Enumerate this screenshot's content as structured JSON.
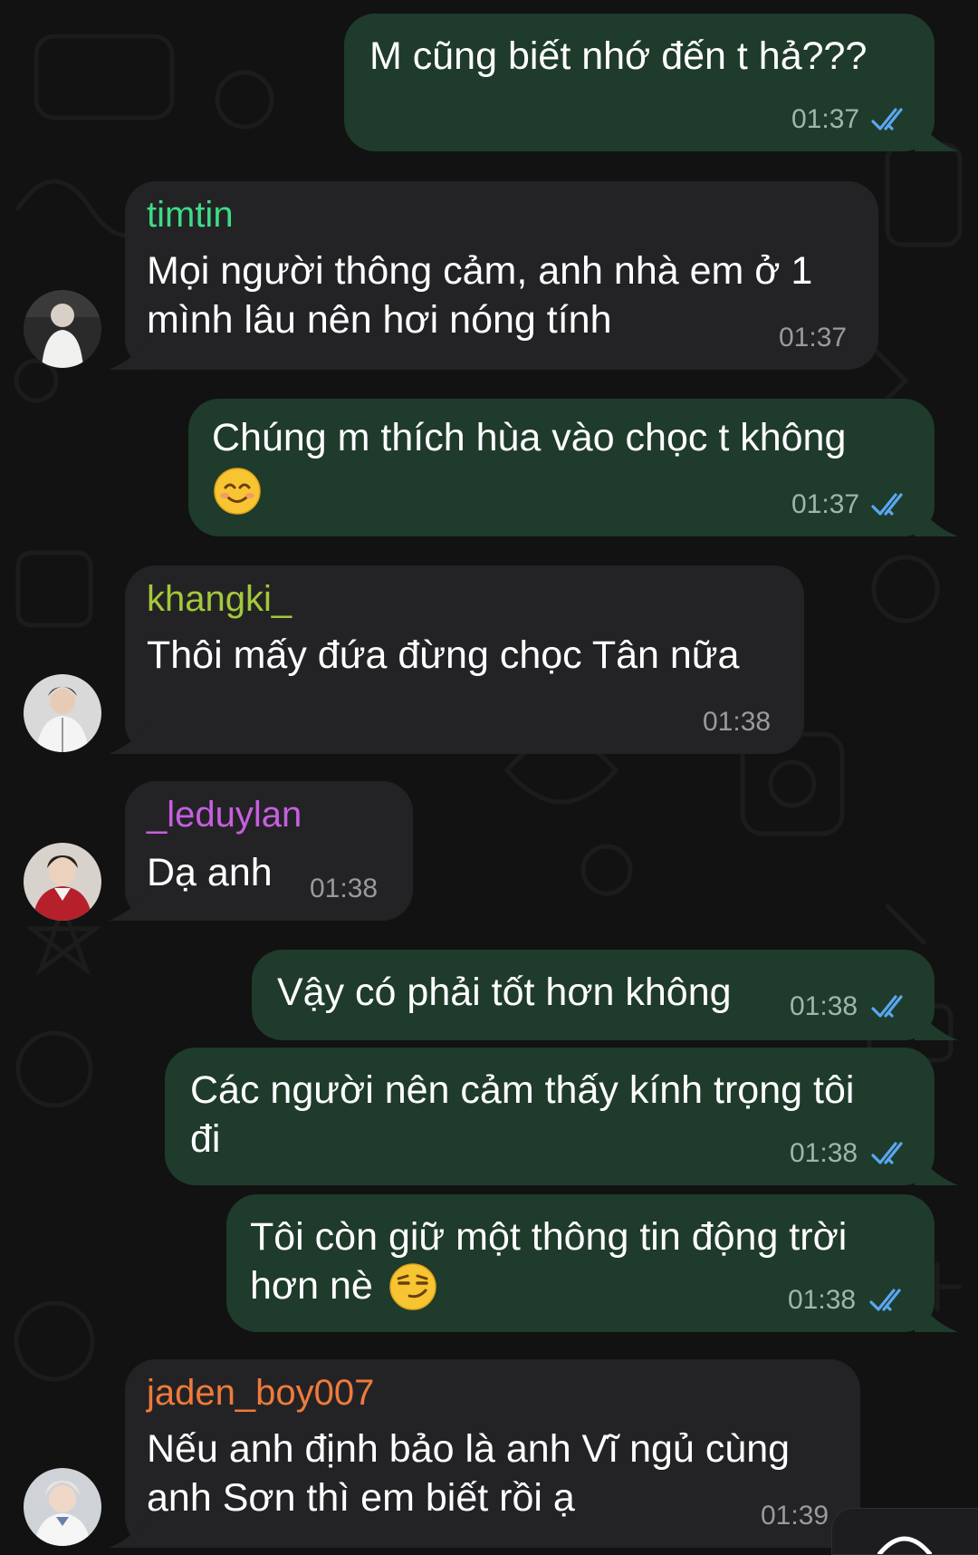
{
  "colors": {
    "outgoing_bubble": "#1f3b2b",
    "incoming_bubble": "#232326",
    "read_check": "#5aa7f2",
    "sender_timtin": "#3ddc84",
    "sender_khangki": "#a3c93a",
    "sender_leduylan": "#c75fe0",
    "sender_jaden": "#f07a3a"
  },
  "messages": [
    {
      "direction": "out",
      "lines": [
        "M cũng biết nhớ đến t hả???"
      ],
      "time": "01:37",
      "status": "read"
    },
    {
      "direction": "in",
      "sender": "timtin",
      "lines": [
        "Mọi người thông cảm, anh nhà em ở 1",
        "mình lâu nên hơi nóng tính"
      ],
      "time": "01:37"
    },
    {
      "direction": "out",
      "lines": [
        "Chúng m thích hùa vào chọc t không"
      ],
      "emoji": "smiling-face-emoji",
      "time": "01:37",
      "status": "read"
    },
    {
      "direction": "in",
      "sender": "khangki_",
      "lines": [
        "Thôi mấy đứa đừng chọc Tân nữa"
      ],
      "time": "01:38"
    },
    {
      "direction": "in",
      "sender": "_leduylan",
      "lines": [
        "Dạ anh"
      ],
      "time": "01:38"
    },
    {
      "direction": "out",
      "lines": [
        "Vậy có phải tốt hơn không"
      ],
      "time": "01:38",
      "status": "read"
    },
    {
      "direction": "out",
      "lines": [
        "Các người nên cảm thấy kính trọng tôi",
        "đi"
      ],
      "time": "01:38",
      "status": "read"
    },
    {
      "direction": "out",
      "lines": [
        "Tôi còn giữ một thông tin động trời",
        "hơn nè"
      ],
      "emoji": "smirking-face-emoji",
      "time": "01:38",
      "status": "read"
    },
    {
      "direction": "in",
      "sender": "jaden_boy007",
      "lines": [
        "Nếu anh định bảo là anh Vĩ ngủ cùng",
        "anh Sơn thì em biết rồi ạ"
      ],
      "time": "01:39"
    }
  ]
}
